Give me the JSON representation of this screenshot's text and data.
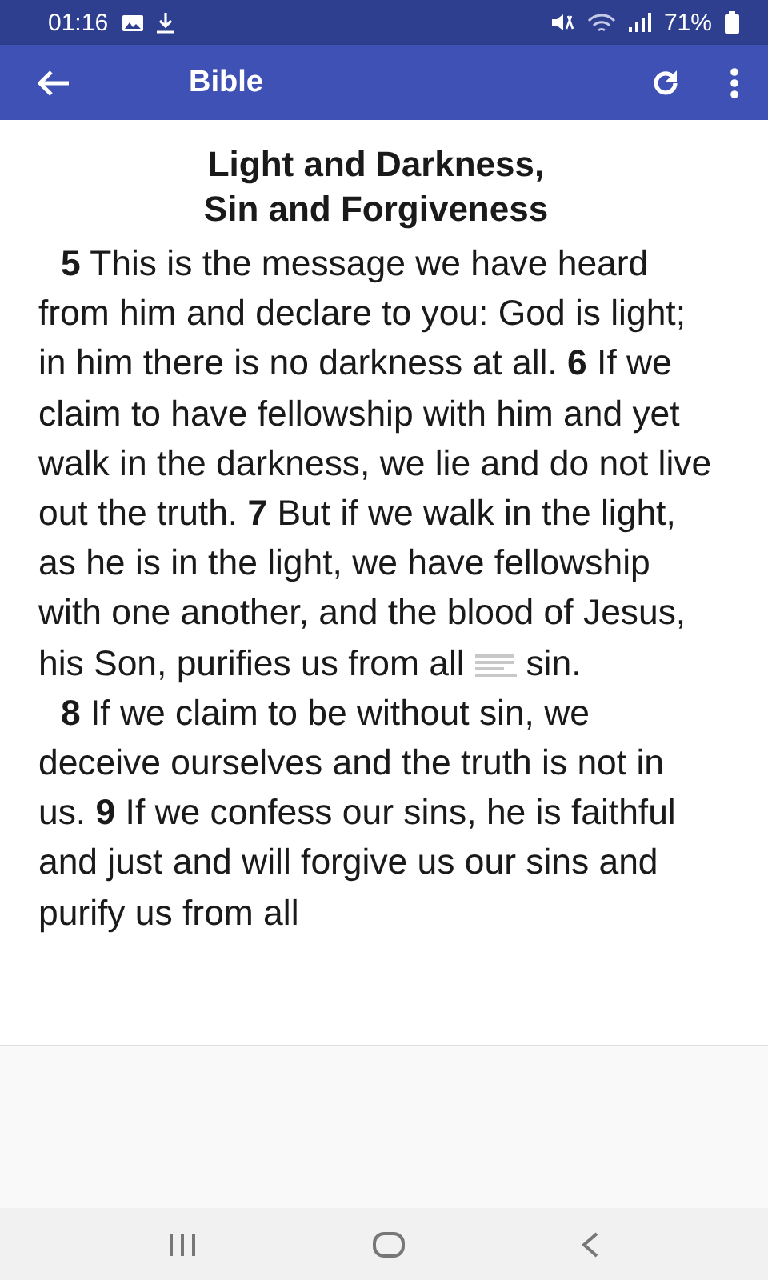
{
  "status_bar": {
    "time": "01:16",
    "battery": "71%"
  },
  "app_bar": {
    "title": "Bible"
  },
  "heading": [
    "Light and Darkness,",
    "Sin and Forgiveness"
  ],
  "paragraphs": [
    {
      "segments": [
        {
          "kind": "text",
          "text": "**5** This is the message we have heard from him and declare to you: God is light; in him there is no darkness at all. **6** If we claim to have fellowship with him and yet walk in the darkness, we lie and do not live out the truth. **7** But if we walk in the light, as he is in the light, we have fellowship with one another, and the blood of Jesus, his Son, purifies us from all"
        },
        {
          "kind": "note"
        },
        {
          "kind": "text",
          "text": "sin."
        }
      ]
    },
    {
      "segments": [
        {
          "kind": "text",
          "text": "**8** If we claim to be without sin, we deceive ourselves and the truth is not in us. **9** If we confess our sins, he is faithful and just and will forgive us our sins and purify us from all"
        }
      ]
    }
  ]
}
